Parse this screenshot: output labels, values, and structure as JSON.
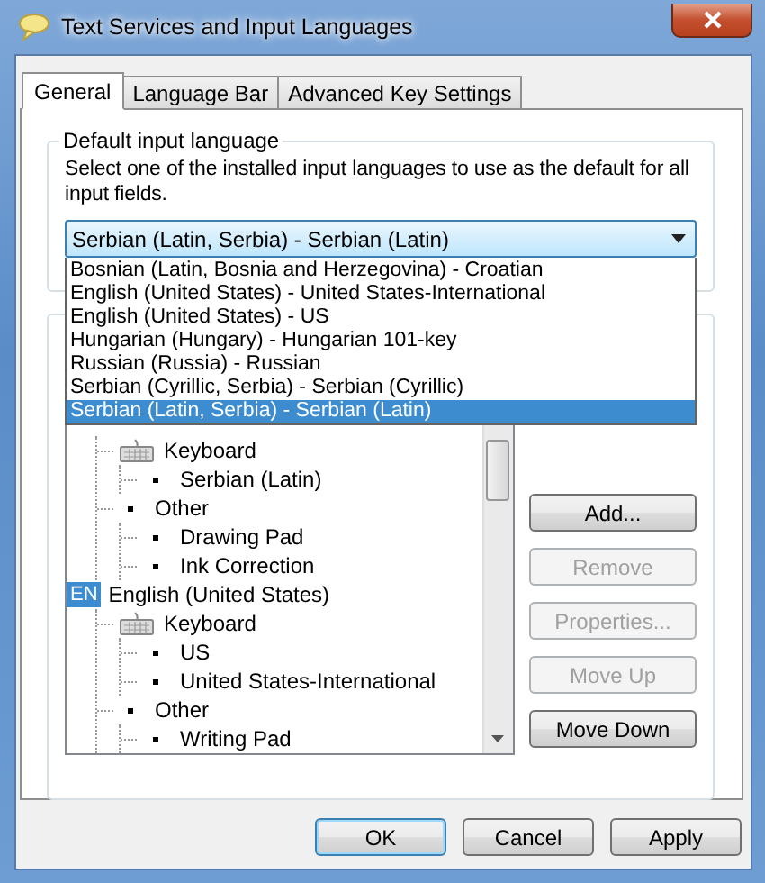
{
  "window": {
    "title": "Text Services and Input Languages"
  },
  "tabs": [
    {
      "label": "General",
      "selected": true
    },
    {
      "label": "Language Bar",
      "selected": false
    },
    {
      "label": "Advanced Key Settings",
      "selected": false
    }
  ],
  "default_language": {
    "legend": "Default input language",
    "description": "Select one of the installed input languages to use as the default for all input fields.",
    "value": "Serbian (Latin, Serbia) - Serbian (Latin)",
    "expanded": true,
    "options": [
      {
        "label": "Bosnian (Latin, Bosnia and Herzegovina) - Croatian",
        "selected": false
      },
      {
        "label": "English (United States) - United States-International",
        "selected": false
      },
      {
        "label": "English (United States) - US",
        "selected": false
      },
      {
        "label": "Hungarian (Hungary) - Hungarian 101-key",
        "selected": false
      },
      {
        "label": "Russian (Russia) - Russian",
        "selected": false
      },
      {
        "label": "Serbian (Cyrillic, Serbia) - Serbian (Cyrillic)",
        "selected": false
      },
      {
        "label": "Serbian (Latin, Serbia) - Serbian (Latin)",
        "selected": true
      }
    ]
  },
  "installed_services": {
    "tree": [
      {
        "kind": "language",
        "children": [
          {
            "kind": "keyboard",
            "label": "Keyboard",
            "children": [
              {
                "kind": "service",
                "label": "Serbian (Latin)"
              }
            ]
          },
          {
            "kind": "category",
            "label": "Other",
            "children": [
              {
                "kind": "service",
                "label": "Drawing Pad"
              },
              {
                "kind": "service",
                "label": "Ink Correction"
              }
            ]
          }
        ]
      },
      {
        "kind": "language",
        "badge": "EN",
        "label": "English (United States)",
        "children": [
          {
            "kind": "keyboard",
            "label": "Keyboard",
            "children": [
              {
                "kind": "service",
                "label": "US"
              },
              {
                "kind": "service",
                "label": "United States-International"
              }
            ]
          },
          {
            "kind": "category",
            "label": "Other",
            "children": [
              {
                "kind": "service",
                "label": "Writing Pad"
              }
            ]
          }
        ]
      }
    ],
    "buttons": [
      {
        "label": "Add...",
        "disabled": false
      },
      {
        "label": "Remove",
        "disabled": true
      },
      {
        "label": "Properties...",
        "disabled": true
      },
      {
        "label": "Move Up",
        "disabled": true
      },
      {
        "label": "Move Down",
        "disabled": false
      }
    ]
  },
  "dialog_buttons": [
    {
      "label": "OK",
      "default": true
    },
    {
      "label": "Cancel",
      "default": false
    },
    {
      "label": "Apply",
      "default": false
    }
  ]
}
